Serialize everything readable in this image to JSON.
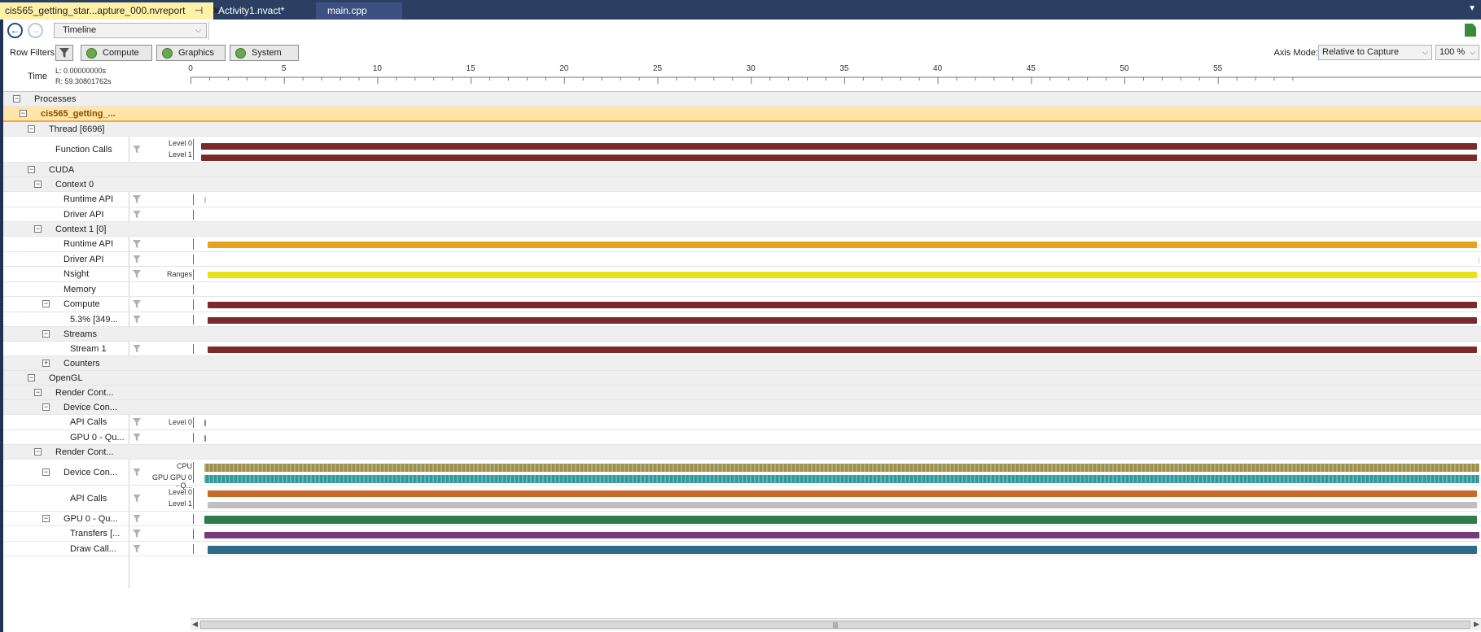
{
  "tabs": [
    {
      "label": "cis565_getting_star...apture_000.nvreport",
      "active": true
    },
    {
      "label": "Activity1.nvact*",
      "active": false
    },
    {
      "label": "main.cpp",
      "active": false
    }
  ],
  "toolbar": {
    "view_select": "Timeline",
    "back_icon": "back-arrow-icon",
    "forward_icon": "forward-arrow-icon"
  },
  "filterbar": {
    "row_filters_label": "Row Filters",
    "buttons": [
      "Compute",
      "Graphics",
      "System"
    ],
    "axis_mode_label": "Axis Mode:",
    "axis_mode_value": "Relative to Capture",
    "zoom_value": "100 %"
  },
  "ruler": {
    "time_label": "Time",
    "left_time": "L: 0.00000000s",
    "right_time": "R: 59.30801762s",
    "ticks": [
      "0",
      "5",
      "10",
      "15",
      "20",
      "25",
      "30",
      "35",
      "40",
      "45",
      "50",
      "55"
    ]
  },
  "rows": [
    {
      "label": "Processes",
      "group": true,
      "expander": "minus"
    },
    {
      "label": "cis565_getting_...",
      "highlight": true,
      "expander": "minus"
    },
    {
      "label": "Thread [6696]",
      "group": true,
      "expander": "minus"
    },
    {
      "label": "Function Calls",
      "filter": true,
      "levels": [
        "Level 0",
        "Level 1"
      ]
    },
    {
      "label": "CUDA",
      "group": true,
      "expander": "minus"
    },
    {
      "label": "Context 0",
      "group": true,
      "expander": "minus"
    },
    {
      "label": "Runtime API",
      "filter": true
    },
    {
      "label": "Driver API",
      "filter": true
    },
    {
      "label": "Context 1 [0]",
      "group": true,
      "expander": "minus"
    },
    {
      "label": "Runtime API",
      "filter": true
    },
    {
      "label": "Driver API",
      "filter": true
    },
    {
      "label": "Nsight",
      "filter": true,
      "levels": [
        "Ranges"
      ]
    },
    {
      "label": "Memory"
    },
    {
      "label": "Compute",
      "filter": true,
      "expander": "minus"
    },
    {
      "label": "5.3% [349...",
      "filter": true
    },
    {
      "label": "Streams",
      "group": true,
      "expander": "minus"
    },
    {
      "label": "Stream 1",
      "filter": true
    },
    {
      "label": "Counters",
      "group": true,
      "expander": "plus"
    },
    {
      "label": "OpenGL",
      "group": true,
      "expander": "minus"
    },
    {
      "label": "Render Cont...",
      "group": true,
      "expander": "minus"
    },
    {
      "label": "Device Con...",
      "group": true,
      "expander": "minus"
    },
    {
      "label": "API Calls",
      "filter": true,
      "levels": [
        "Level 0"
      ]
    },
    {
      "label": "GPU 0 - Qu...",
      "filter": true
    },
    {
      "label": "Render Cont...",
      "group": true,
      "expander": "minus"
    },
    {
      "label": "Device Con...",
      "filter": true,
      "expander": "minus",
      "levels": [
        "CPU",
        "GPU GPU 0 - Q..."
      ]
    },
    {
      "label": "API Calls",
      "filter": true,
      "levels": [
        "Level 0",
        "Level 1"
      ]
    },
    {
      "label": "GPU 0 - Qu...",
      "filter": true,
      "expander": "minus"
    },
    {
      "label": "Transfers [...",
      "filter": true
    },
    {
      "label": "Draw Call...",
      "filter": true
    }
  ],
  "colors": {
    "function_calls": "#7a2a2a",
    "runtime_api": "#e6a21f",
    "nsight_ranges": "#e6e21a",
    "compute": "#7a2a2a",
    "cpu_bar": "#9c8f4a",
    "gpu_bar": "#2f9a9a",
    "api_level0": "#c86a2a",
    "api_level1": "#c0c0c0",
    "gpu_queue": "#2e7d4a",
    "transfers": "#7a3a7a",
    "draw_calls": "#2f6a8a",
    "highlight": "#f2a93b"
  }
}
